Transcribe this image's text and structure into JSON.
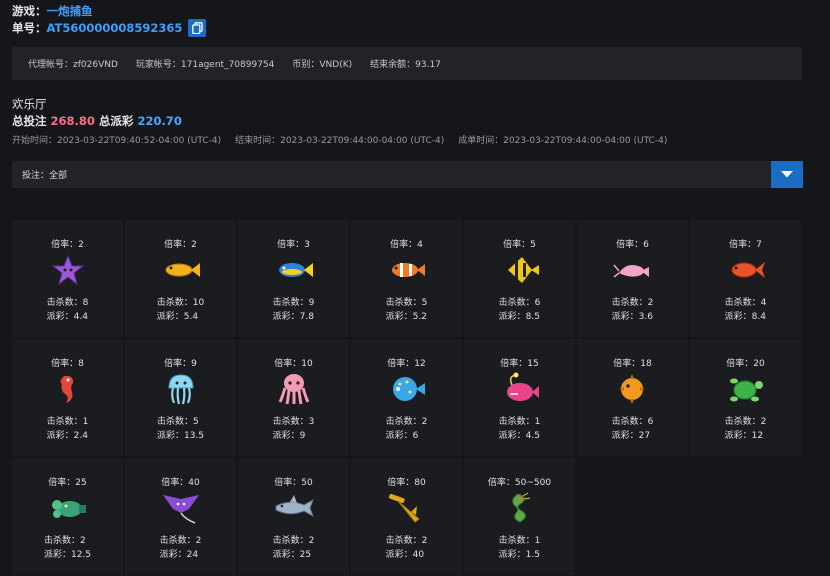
{
  "header": {
    "game_label": "游戏：",
    "game_value": "一炮捕鱼",
    "order_label": "单号：",
    "order_value": "AT560000008592365"
  },
  "info": {
    "agent": "代理帐号：zf026VND",
    "player": "玩家帐号：171agent_70899754",
    "currency": "币别：VND(K)",
    "balance": "结束余额：93.17"
  },
  "hall": "欢乐厅",
  "totals": {
    "bet_label": "总投注",
    "bet_value": "268.80",
    "win_label": "总派彩",
    "win_value": "220.70"
  },
  "times": {
    "start": "开始时间：2023-03-22T09:40:52-04:00 (UTC-4)",
    "end": "结束时间：2023-03-22T09:44:00-04:00 (UTC-4)",
    "settle": "成单时间：2023-03-22T09:44:00-04:00 (UTC-4)"
  },
  "filter": {
    "label": "投注：全部"
  },
  "fish": [
    {
      "rate": "倍率：2",
      "kills": "击杀数：8",
      "payout": "派彩：4.4",
      "icon": "starfish-icon",
      "color": "#9b59d6"
    },
    {
      "rate": "倍率：2",
      "kills": "击杀数：10",
      "payout": "派彩：5.4",
      "icon": "yellow-fish-icon",
      "color": "#f2b01e"
    },
    {
      "rate": "倍率：3",
      "kills": "击杀数：9",
      "payout": "派彩：7.8",
      "icon": "blue-fish-icon",
      "color": "#2f7fe0"
    },
    {
      "rate": "倍率：4",
      "kills": "击杀数：5",
      "payout": "派彩：5.2",
      "icon": "clownfish-icon",
      "color": "#f07a2a"
    },
    {
      "rate": "倍率：5",
      "kills": "击杀数：6",
      "payout": "派彩：8.5",
      "icon": "angelfish-icon",
      "color": "#f0c419"
    },
    {
      "rate": "倍率：6",
      "kills": "击杀数：2",
      "payout": "派彩：3.6",
      "icon": "pink-shrimp-icon",
      "color": "#f4a3c8"
    },
    {
      "rate": "倍率：7",
      "kills": "击杀数：4",
      "payout": "派彩：8.4",
      "icon": "red-goldfish-icon",
      "color": "#e8532a"
    },
    {
      "rate": "倍率：8",
      "kills": "击杀数：1",
      "payout": "派彩：2.4",
      "icon": "seahorse-icon",
      "color": "#e2473b"
    },
    {
      "rate": "倍率：9",
      "kills": "击杀数：5",
      "payout": "派彩：13.5",
      "icon": "jellyfish-icon",
      "color": "#8fd6ef"
    },
    {
      "rate": "倍率：10",
      "kills": "击杀数：3",
      "payout": "派彩：9",
      "icon": "octopus-icon",
      "color": "#f49ab2"
    },
    {
      "rate": "倍率：12",
      "kills": "击杀数：2",
      "payout": "派彩：6",
      "icon": "pufferfish-icon",
      "color": "#3aa7e8"
    },
    {
      "rate": "倍率：15",
      "kills": "击杀数：1",
      "payout": "派彩：4.5",
      "icon": "anglerfish-icon",
      "color": "#e8458a"
    },
    {
      "rate": "倍率：18",
      "kills": "击杀数：6",
      "payout": "派彩：27",
      "icon": "spiky-pufferfish-icon",
      "color": "#f29a1e"
    },
    {
      "rate": "倍率：20",
      "kills": "击杀数：2",
      "payout": "派彩：12",
      "icon": "turtle-icon",
      "color": "#3bb34a"
    },
    {
      "rate": "倍率：25",
      "kills": "击杀数：2",
      "payout": "派彩：12.5",
      "icon": "green-lobster-icon",
      "color": "#3aa37a"
    },
    {
      "rate": "倍率：40",
      "kills": "击杀数：2",
      "payout": "派彩：24",
      "icon": "manta-ray-icon",
      "color": "#8a4bd6"
    },
    {
      "rate": "倍率：50",
      "kills": "击杀数：2",
      "payout": "派彩：25",
      "icon": "shark-icon",
      "color": "#9fb3c8"
    },
    {
      "rate": "倍率：80",
      "kills": "击杀数：2",
      "payout": "派彩：40",
      "icon": "hammerhead-icon",
      "color": "#e2a61c"
    },
    {
      "rate": "倍率：50~500",
      "kills": "击杀数：1",
      "payout": "派彩：1.5",
      "icon": "dragon-icon",
      "color": "#5fa84a"
    }
  ]
}
